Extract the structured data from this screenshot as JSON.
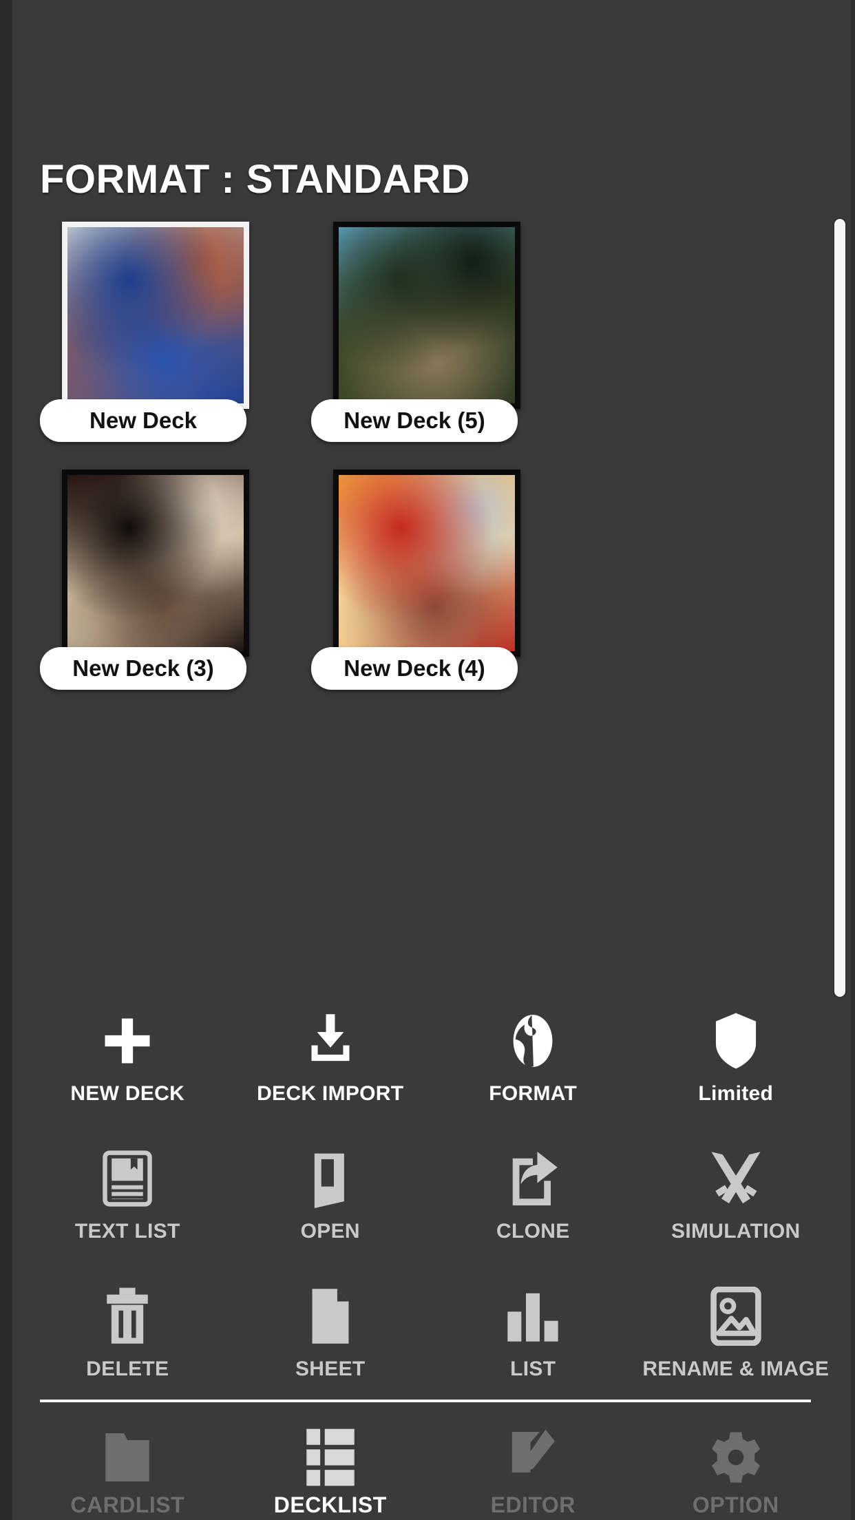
{
  "app": {
    "background_color": "#3a3a3a",
    "accent_color": "#ffffff"
  },
  "header": {
    "title": "FORMAT : STANDARD"
  },
  "decks": [
    {
      "label": "New Deck",
      "selected": true,
      "art": "blue-dragon-sorcerer",
      "art_colors": [
        "#cfd6d4",
        "#1f3f8f",
        "#7a5a6a",
        "#2b55b0",
        "#b05a3a"
      ]
    },
    {
      "label": "New Deck (5)",
      "selected": false,
      "art": "green-ranger-hunter",
      "art_colors": [
        "#5fa8c8",
        "#22301f",
        "#3f4a2a",
        "#8c7a5a",
        "#0f1a12"
      ]
    },
    {
      "label": "New Deck (3)",
      "selected": false,
      "art": "white-black-knight",
      "art_colors": [
        "#2a1512",
        "#120c0a",
        "#c8b49a",
        "#6a5040",
        "#e0d2c0"
      ]
    },
    {
      "label": "New Deck (4)",
      "selected": false,
      "art": "red-fire-pyromancer",
      "art_colors": [
        "#f2a33c",
        "#c62a20",
        "#f6d79a",
        "#8d4a3a",
        "#b9c3cc"
      ]
    }
  ],
  "scrollbar": {
    "name": "deck-list-scrollbar",
    "color": "#f5f5f5"
  },
  "toolbar": {
    "rows": [
      [
        {
          "label": "NEW DECK",
          "icon": "plus-icon",
          "state": "bright"
        },
        {
          "label": "DECK IMPORT",
          "icon": "download-icon",
          "state": "bright"
        },
        {
          "label": "FORMAT",
          "icon": "globe-icon",
          "state": "bright"
        },
        {
          "label": "Limited",
          "icon": "shield-icon",
          "state": "bright"
        }
      ],
      [
        {
          "label": "TEXT LIST",
          "icon": "book-icon",
          "state": "dim"
        },
        {
          "label": "OPEN",
          "icon": "door-open-icon",
          "state": "dim"
        },
        {
          "label": "CLONE",
          "icon": "share-page-icon",
          "state": "dim"
        },
        {
          "label": "SIMULATION",
          "icon": "crossed-swords-icon",
          "state": "dim"
        }
      ],
      [
        {
          "label": "DELETE",
          "icon": "trash-icon",
          "state": "dim"
        },
        {
          "label": "SHEET",
          "icon": "document-icon",
          "state": "dim"
        },
        {
          "label": "LIST",
          "icon": "bar-chart-icon",
          "state": "dim"
        },
        {
          "label": "RENAME & IMAGE",
          "icon": "image-icon",
          "state": "dim"
        }
      ]
    ]
  },
  "bottom_nav": {
    "items": [
      {
        "label": "CARDLIST",
        "icon": "folder-icon",
        "active": false
      },
      {
        "label": "DECKLIST",
        "icon": "grid-list-icon",
        "active": true
      },
      {
        "label": "EDITOR",
        "icon": "edit-page-icon",
        "active": false
      },
      {
        "label": "OPTION",
        "icon": "gear-icon",
        "active": false
      }
    ]
  }
}
